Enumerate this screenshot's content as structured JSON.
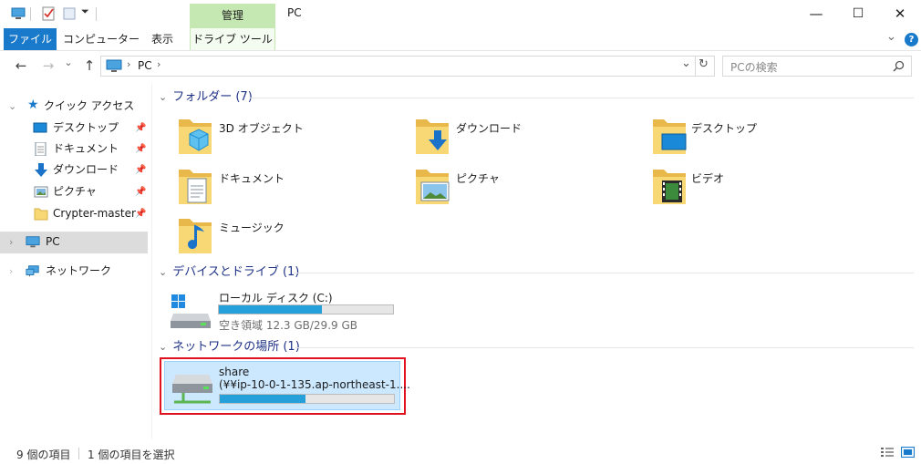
{
  "window": {
    "title": "PC",
    "manage_tab": "管理",
    "minimize": "—",
    "maximize": "☐",
    "close": "✕"
  },
  "ribbon": {
    "file": "ファイル",
    "computer": "コンピューター",
    "view": "表示",
    "drive_tools": "ドライブ ツール",
    "expand": "⌄",
    "help": "?"
  },
  "address": {
    "back": "←",
    "forward": "→",
    "dropdown": "⌄",
    "up": "↑",
    "path": "PC",
    "sep1": "›",
    "sep2": "›",
    "history": "⌄",
    "refresh": "↻",
    "search_placeholder": "PCの検索"
  },
  "nav": {
    "quick_access": "クイック アクセス",
    "items": [
      {
        "label": "デスクトップ"
      },
      {
        "label": "ドキュメント"
      },
      {
        "label": "ダウンロード"
      },
      {
        "label": "ピクチャ"
      },
      {
        "label": "Crypter-master"
      }
    ],
    "pc": "PC",
    "network": "ネットワーク"
  },
  "content": {
    "folders_header": "フォルダー (7)",
    "folders": [
      {
        "label": "3D オブジェクト"
      },
      {
        "label": "ダウンロード"
      },
      {
        "label": "デスクトップ"
      },
      {
        "label": "ドキュメント"
      },
      {
        "label": "ピクチャ"
      },
      {
        "label": "ビデオ"
      },
      {
        "label": "ミュージック"
      }
    ],
    "devices_header": "デバイスとドライブ (1)",
    "local_disk": {
      "name": "ローカル ディスク (C:)",
      "free": "空き領域 12.3 GB/29.9 GB",
      "used_fraction": 0.59
    },
    "network_header": "ネットワークの場所 (1)",
    "share": {
      "name": "share",
      "path": "(¥¥ip-10-0-1-135.ap-northeast-1....",
      "used_fraction": 0.49
    }
  },
  "status": {
    "count": "9 個の項目",
    "selected": "1 個の項目を選択"
  },
  "colors": {
    "accent": "#1979ca",
    "manage": "#c5e8b2",
    "selection": "#cce8ff",
    "highlight": "#e0121f",
    "bar": "#26a0da"
  }
}
